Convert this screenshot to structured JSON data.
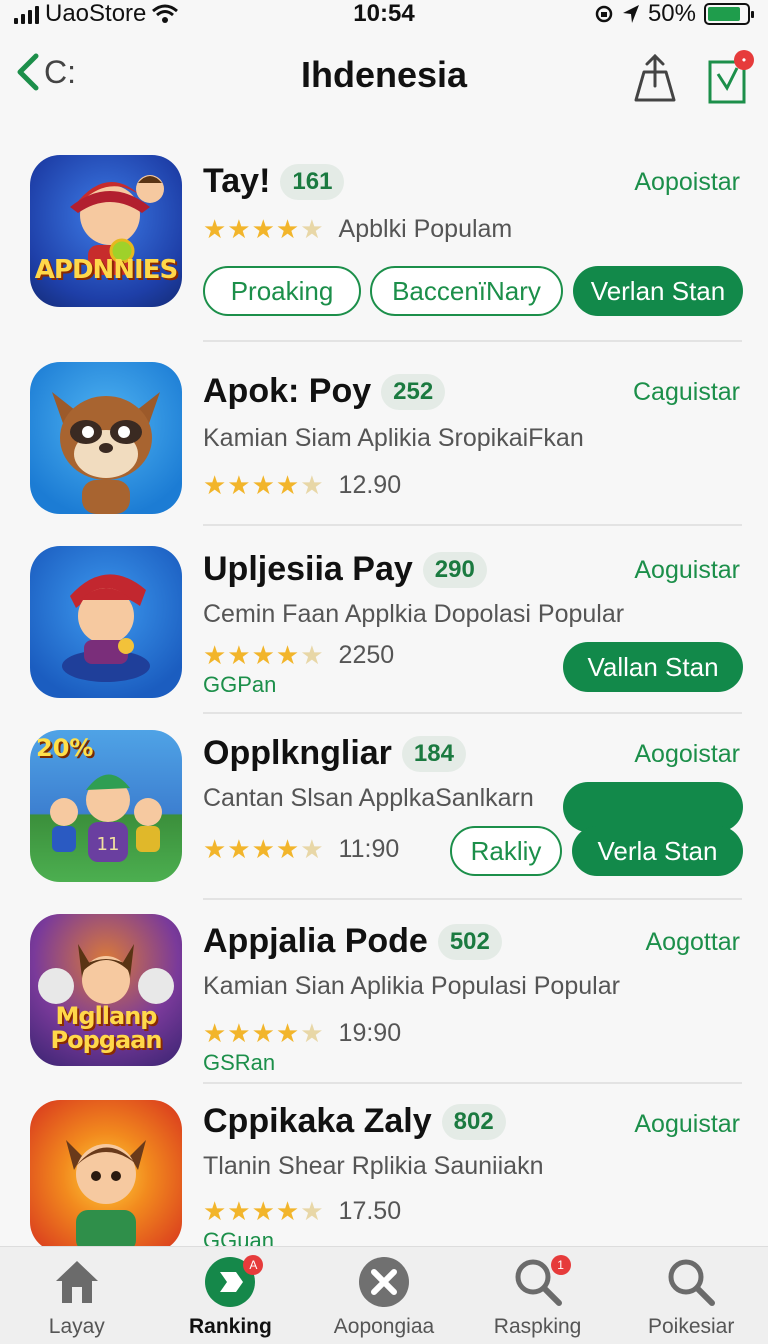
{
  "status": {
    "carrier": "UaoStore",
    "time": "10:54",
    "battery": "50%"
  },
  "nav": {
    "back_label": "C:",
    "title": "Ihdenesia"
  },
  "apps": [
    {
      "title": "Tay!",
      "rank": "161",
      "get": "Aopoistar",
      "subtitle": "Apblki Populam",
      "rating_value": "",
      "stars": 4.5,
      "icon_text": "APDNNIES",
      "buttons": [
        "Proaking",
        "BaccenïNary",
        "Verlan Stan"
      ]
    },
    {
      "title": "Apok: Poy",
      "rank": "252",
      "get": "Caguistar",
      "subtitle": "Kamian Siam Aplikia SropikaiFkan",
      "rating_value": "12.90",
      "stars": 4.5
    },
    {
      "title": "Upljesiia Pay",
      "rank": "290",
      "get": "Aoguistar",
      "subtitle": "Cemin Faan Applkia Dopolasi Popular",
      "rating_value": "2250",
      "stars": 4.5,
      "tag": "GGPan",
      "buttons": [
        "Vallan Stan"
      ]
    },
    {
      "title": "Opplkngliar",
      "rank": "184",
      "get": "Aogoistar",
      "subtitle": "Cantan Slsan ApplkaSanlkarn",
      "rating_value": "11:90",
      "stars": 4.5,
      "icon_text": "20%",
      "buttons": [
        "Rakliy",
        "Verla Stan"
      ]
    },
    {
      "title": "Appjalia Pode",
      "rank": "502",
      "get": "Aogottar",
      "subtitle": "Kamian Sian Aplikia Populasi Popular",
      "rating_value": "19:90",
      "stars": 4.5,
      "icon_text": "Mgllanp Popgaan",
      "tag": "GSRan"
    },
    {
      "title": "Cppikaka Zaly",
      "rank": "802",
      "get": "Aoguistar",
      "subtitle": "Tlanin Shear Rplikia Sauniiakn",
      "rating_value": "17.50",
      "stars": 4.5,
      "tag": "GGuan"
    }
  ],
  "tabs": [
    {
      "label": "Layay",
      "icon": "home-icon"
    },
    {
      "label": "Ranking",
      "icon": "ranking-icon",
      "badge": "A"
    },
    {
      "label": "Aopongiaa",
      "icon": "close-circle-icon"
    },
    {
      "label": "Raspking",
      "icon": "search-icon",
      "badge": "1"
    },
    {
      "label": "Poikesiar",
      "icon": "search-icon"
    }
  ],
  "colors": {
    "accent": "#1c8f4a",
    "button_fill": "#12894a",
    "star": "#f2b52b",
    "badge": "#e63b3b"
  }
}
